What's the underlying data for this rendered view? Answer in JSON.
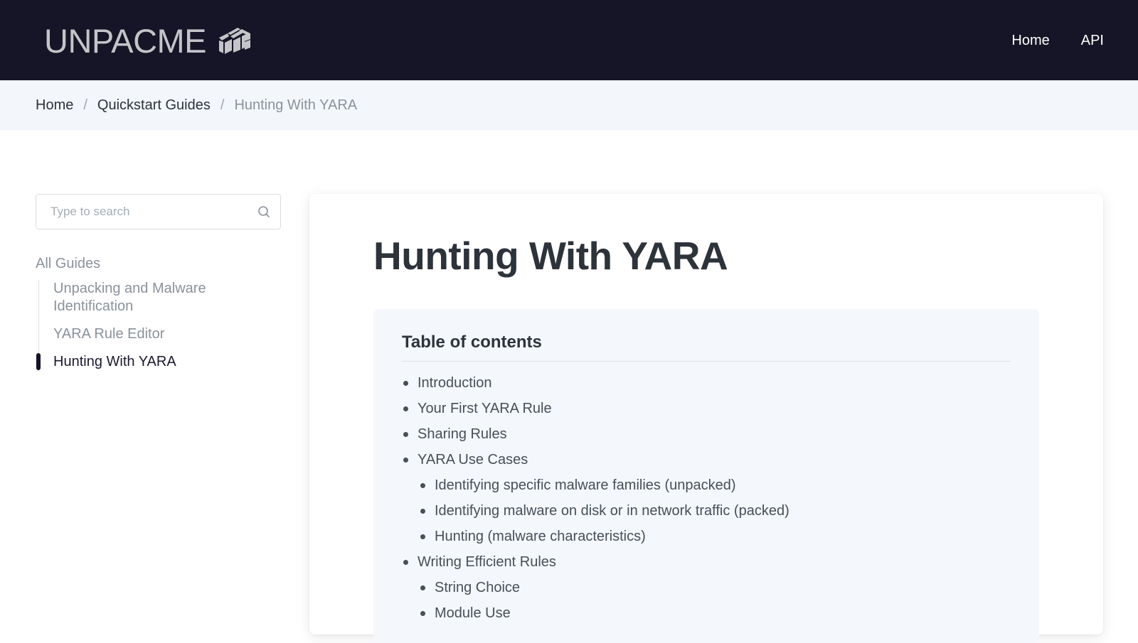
{
  "header": {
    "logo_text": "UNPACME",
    "nav": [
      "Home",
      "API"
    ]
  },
  "breadcrumb": {
    "items": [
      "Home",
      "Quickstart Guides"
    ],
    "current": "Hunting With YARA",
    "separator": "/"
  },
  "search": {
    "placeholder": "Type to search"
  },
  "sidebar": {
    "group_label": "All Guides",
    "items": [
      {
        "label": "Unpacking and Malware Identification",
        "active": false
      },
      {
        "label": "YARA Rule Editor",
        "active": false
      },
      {
        "label": "Hunting With YARA",
        "active": true
      }
    ]
  },
  "article": {
    "title": "Hunting With YARA",
    "toc": {
      "heading": "Table of contents",
      "items": [
        {
          "label": "Introduction"
        },
        {
          "label": "Your First YARA Rule"
        },
        {
          "label": "Sharing Rules"
        },
        {
          "label": "YARA Use Cases",
          "children": [
            "Identifying specific malware families (unpacked)",
            "Identifying malware on disk or in network traffic (packed)",
            "Hunting (malware characteristics)"
          ]
        },
        {
          "label": "Writing Efficient Rules",
          "children": [
            "String Choice",
            "Module Use"
          ]
        }
      ]
    }
  },
  "colors": {
    "header_bg": "#161527",
    "breadcrumb_bg": "#f3f6fb",
    "toc_bg": "#f4f7fb",
    "active_indicator": "#161527"
  }
}
